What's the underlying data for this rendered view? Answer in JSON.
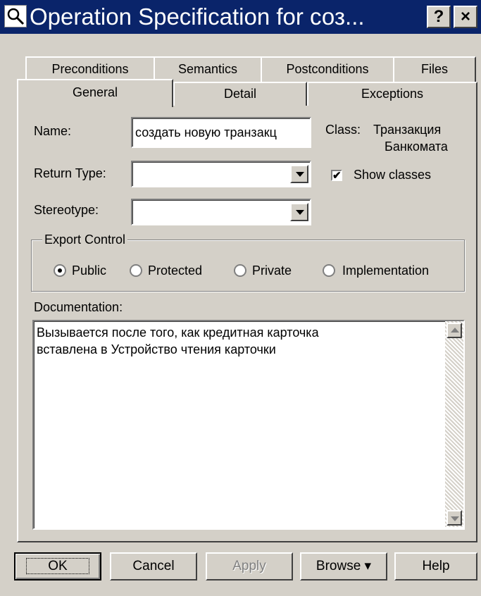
{
  "window": {
    "title": "Operation Specification for соз...",
    "help_glyph": "?",
    "close_glyph": "×",
    "title_icon": "magnifier-icon"
  },
  "tabs": {
    "row_back": [
      "Preconditions",
      "Semantics",
      "Postconditions",
      "Files"
    ],
    "row_front": [
      "General",
      "Detail",
      "Exceptions"
    ],
    "active": "General"
  },
  "general": {
    "name_label": "Name:",
    "name_value": "создать новую транзакц",
    "class_label": "Class:",
    "class_value_line1": "Транзакция",
    "class_value_line2": "Банкомата",
    "return_type_label": "Return Type:",
    "return_type_value": "",
    "show_classes_label": "Show classes",
    "show_classes_checked": true,
    "stereotype_label": "Stereotype:",
    "stereotype_value": ""
  },
  "export_control": {
    "legend": "Export Control",
    "options": [
      "Public",
      "Protected",
      "Private",
      "Implementation"
    ],
    "selected": "Public"
  },
  "documentation": {
    "label": "Documentation:",
    "line1": "Вызывается после того, как кредитная карточка",
    "line2": "вставлена в Устройство чтения карточки"
  },
  "buttons": {
    "ok": "OK",
    "cancel": "Cancel",
    "apply": "Apply",
    "browse": "Browse ▾",
    "help": "Help"
  },
  "colors": {
    "titlebar": "#0a246a",
    "face": "#d4d0c8"
  }
}
